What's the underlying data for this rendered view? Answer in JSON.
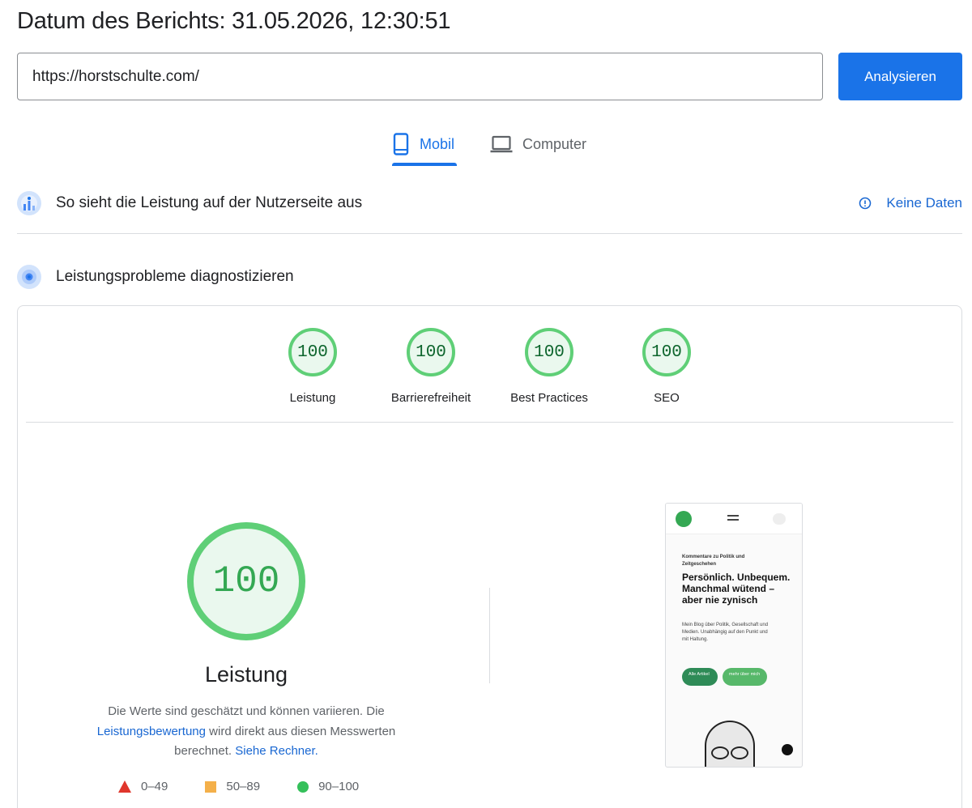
{
  "header": {
    "report_date": "Datum des Berichts: 31.05.2026, 12:30:51"
  },
  "search": {
    "url_value": "https://horstschulte.com/",
    "analyze_label": "Analysieren"
  },
  "tabs": [
    {
      "label": "Mobil",
      "icon": "smartphone-icon",
      "selected": true
    },
    {
      "label": "Computer",
      "icon": "laptop-icon",
      "selected": false
    }
  ],
  "field_data": {
    "title": "So sieht die Leistung auf der Nutzerseite aus",
    "no_data_label": "Keine Daten",
    "icon": "field-data-icon"
  },
  "lab_data": {
    "title": "Leistungsprobleme diagnostizieren",
    "icon": "lab-data-icon"
  },
  "scores": [
    {
      "label": "Leistung",
      "score": "100"
    },
    {
      "label": "Barrierefreiheit",
      "score": "100"
    },
    {
      "label": "Best Practices",
      "score": "100"
    },
    {
      "label": "SEO",
      "score": "100"
    }
  ],
  "performance": {
    "score": "100",
    "title": "Leistung",
    "desc_part1": "Die Werte sind geschätzt und können variieren. Die ",
    "desc_link1": "Leistungsbewertung",
    "desc_part2": " wird direkt aus diesen Messwerten berechnet. ",
    "desc_link2": "Siehe Rechner."
  },
  "legend": [
    {
      "range": "0–49",
      "color": "#e0362c",
      "shape": "triangle"
    },
    {
      "range": "50–89",
      "color": "#f4b04a",
      "shape": "square"
    },
    {
      "range": "90–100",
      "color": "#34c05a",
      "shape": "circle"
    }
  ],
  "preview": {
    "kicker": "Kommentare zu Politik und Zeitgeschehen",
    "headline": "Persönlich. Unbequem. Manchmal wütend – aber nie zynisch",
    "body": "Mein Blog über Politik, Gesellschaft und Medien. Unabhängig auf den Punkt und mit Haltung.",
    "button1": "Alle Artikel",
    "button2": "mehr über mich"
  },
  "colors": {
    "accent": "#1a73e8",
    "link": "#1967d2",
    "pass": "#34a853",
    "pass_ring": "#5fcf77"
  }
}
